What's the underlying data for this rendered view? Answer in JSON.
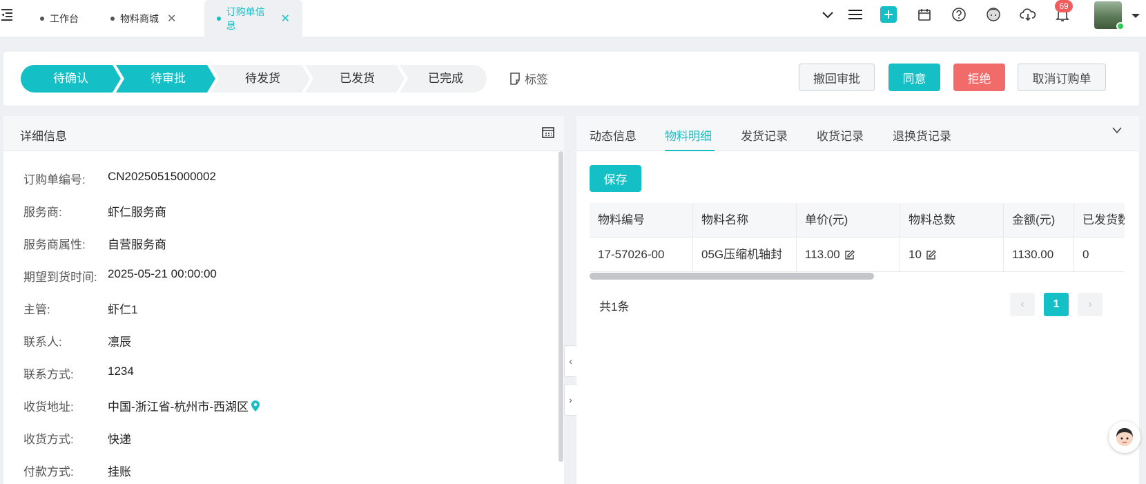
{
  "tabs": [
    {
      "label": "工作台",
      "closable": false
    },
    {
      "label": "物料商城",
      "closable": true
    },
    {
      "label": "订购单信息",
      "closable": true,
      "active": true
    }
  ],
  "topbar": {
    "notification_count": "69",
    "accent": "#14c0c6"
  },
  "status": {
    "steps": [
      {
        "label": "待确认",
        "state": "done"
      },
      {
        "label": "待审批",
        "state": "current"
      },
      {
        "label": "待发货",
        "state": "pending"
      },
      {
        "label": "已发货",
        "state": "pending"
      },
      {
        "label": "已完成",
        "state": "pending"
      }
    ],
    "tag_label": "标签",
    "actions": {
      "withdraw": "撤回审批",
      "approve": "同意",
      "reject": "拒绝",
      "cancel": "取消订购单"
    }
  },
  "details": {
    "title": "详细信息",
    "fields": [
      {
        "label": "订购单编号:",
        "value": "CN20250515000002"
      },
      {
        "label": "服务商:",
        "value": "虾仁服务商",
        "link": true
      },
      {
        "label": "服务商属性:",
        "value": "自营服务商"
      },
      {
        "label": "期望到货时间:",
        "value": "2025-05-21 00:00:00"
      },
      {
        "label": "主管:",
        "value": "虾仁1"
      },
      {
        "label": "联系人:",
        "value": "凛辰"
      },
      {
        "label": "联系方式:",
        "value": "1234"
      },
      {
        "label": "收货地址:",
        "value": "中国-浙江省-杭州市-西湖区",
        "location_icon": true
      },
      {
        "label": "收货方式:",
        "value": "快递"
      },
      {
        "label": "付款方式:",
        "value": "挂账"
      }
    ]
  },
  "materials": {
    "tabs": [
      "动态信息",
      "物料明细",
      "发货记录",
      "收货记录",
      "退换货记录"
    ],
    "active_tab": "物料明细",
    "save_label": "保存",
    "columns": [
      "物料编号",
      "物料名称",
      "单价(元)",
      "物料总数",
      "金额(元)",
      "已发货数"
    ],
    "rows": [
      {
        "code": "17-57026-00",
        "name": "05G压缩机轴封",
        "unit_price": "113.00",
        "quantity": "10",
        "amount": "1130.00",
        "shipped": "0"
      }
    ],
    "total_text": "共1条",
    "pagination": {
      "current": "1",
      "prev": "‹",
      "next": "›"
    }
  }
}
